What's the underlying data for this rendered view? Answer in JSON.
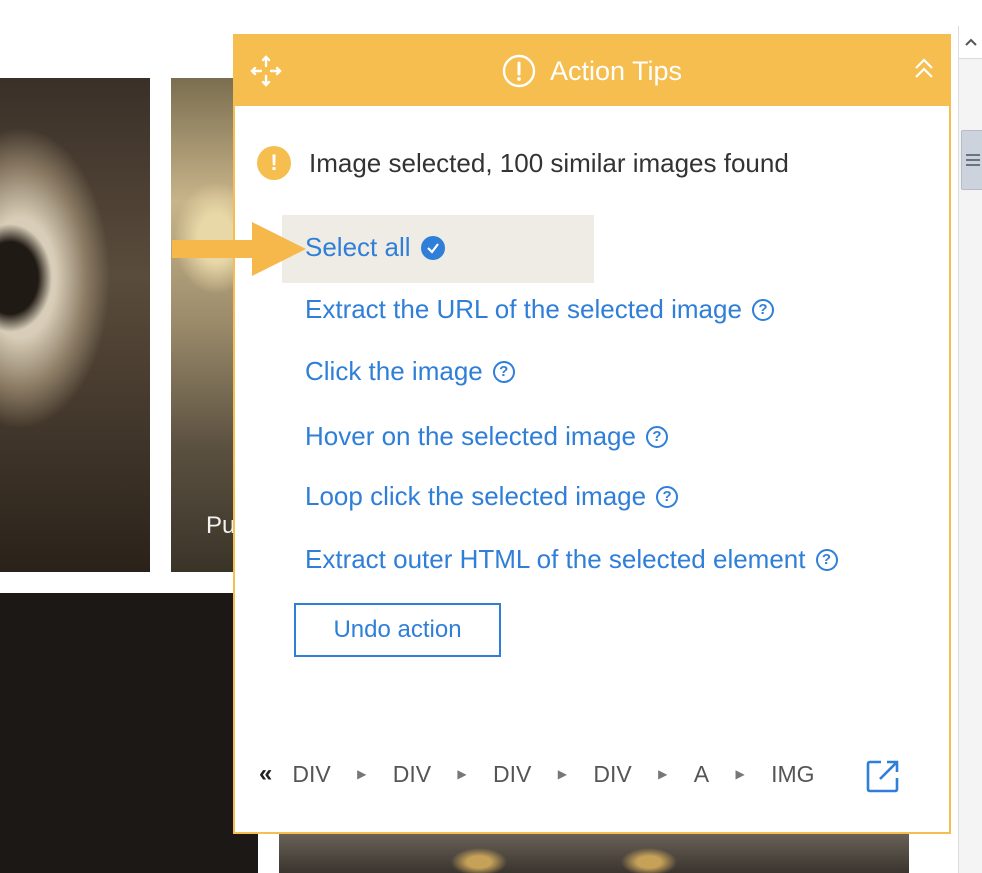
{
  "background": {
    "partial_caption": "Pu"
  },
  "panel": {
    "title": "Action Tips",
    "message": "Image selected, 100 similar images found",
    "actions": [
      {
        "label": "Select all",
        "icon": "check-circle-icon"
      },
      {
        "label": "Extract the URL of the selected image",
        "icon": "help-icon"
      },
      {
        "label": "Click the image",
        "icon": "help-icon"
      },
      {
        "label": "Hover on the selected image",
        "icon": "help-icon"
      },
      {
        "label": "Loop click the selected image",
        "icon": "help-icon"
      },
      {
        "label": "Extract outer HTML of the selected element",
        "icon": "help-icon"
      }
    ],
    "undo_label": "Undo action",
    "breadcrumb": [
      "DIV",
      "DIV",
      "DIV",
      "DIV",
      "A",
      "IMG"
    ]
  },
  "colors": {
    "header": "#f6bd4f",
    "link": "#2f7fd8",
    "arrow": "#f6b84a"
  }
}
